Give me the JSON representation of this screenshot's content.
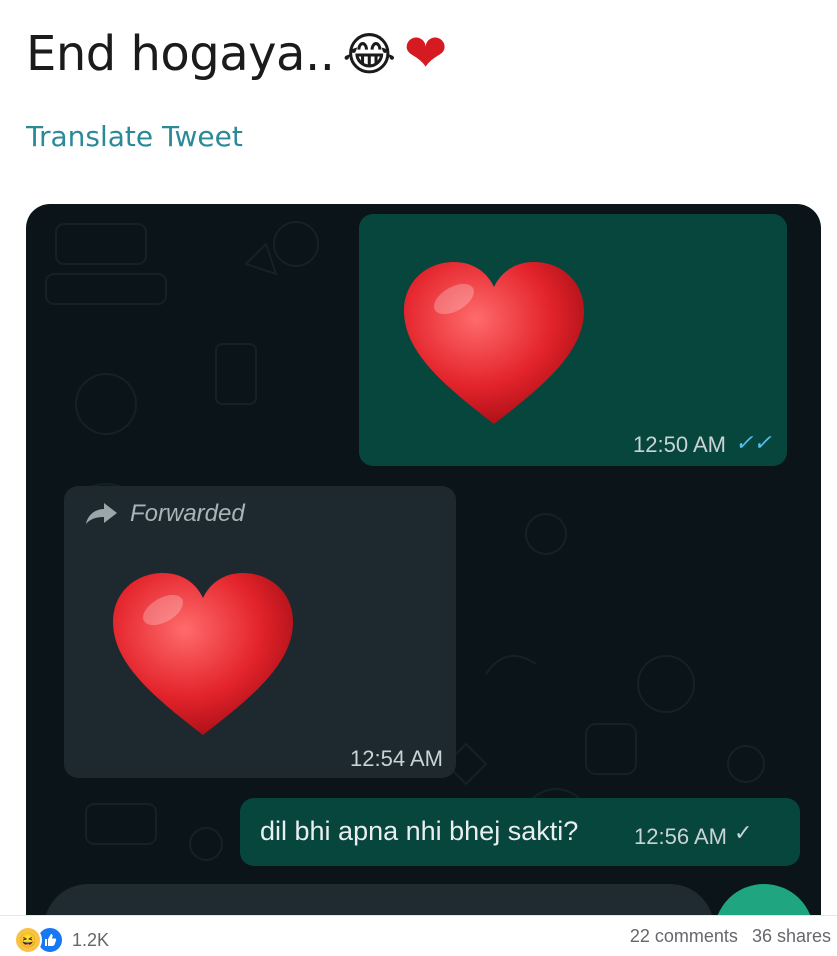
{
  "tweet": {
    "text": "End hogaya..",
    "emoji_laugh": "😂",
    "emoji_heart": "❤",
    "translate_label": "Translate Tweet"
  },
  "chat": {
    "msg1": {
      "time": "12:50 AM",
      "ticks": "✓✓",
      "ticks_color": "#53bdeb",
      "emoji": "heart-emoji"
    },
    "msg2": {
      "forwarded_label": "Forwarded",
      "time": "12:54 AM",
      "emoji": "heart-emoji"
    },
    "msg3": {
      "text": "dil bhi apna nhi bhej sakti?",
      "time": "12:56 AM",
      "ticks": "✓"
    }
  },
  "footer": {
    "reaction_count": "1.2K",
    "comments": "22 comments",
    "shares": "36 shares"
  },
  "colors": {
    "outgoing_bubble": "#07463d",
    "incoming_bubble": "#1d292e",
    "chat_background": "#0b1418",
    "link": "#2b8a98",
    "heart": "#e3232b"
  }
}
